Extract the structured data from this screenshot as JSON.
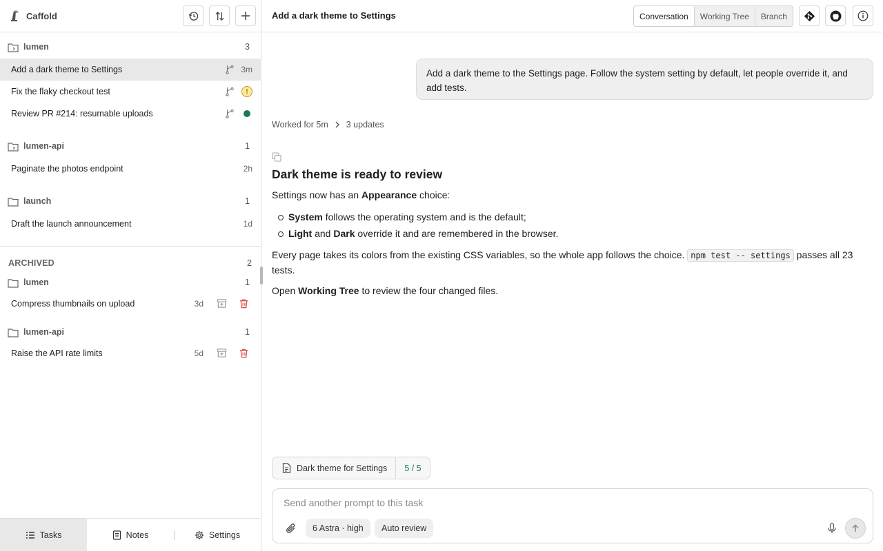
{
  "app": {
    "name": "Caffold"
  },
  "sidebar": {
    "groups": [
      {
        "name": "lumen",
        "count": "3",
        "tasks": [
          {
            "title": "Add a dark theme to Settings",
            "meta": "3m"
          },
          {
            "title": "Fix the flaky checkout test",
            "status": "warning"
          },
          {
            "title": "Review PR #214: resumable uploads",
            "status": "done"
          }
        ]
      },
      {
        "name": "lumen-api",
        "count": "1",
        "tasks": [
          {
            "title": "Paginate the photos endpoint",
            "meta": "2h"
          }
        ]
      },
      {
        "name": "launch",
        "count": "1",
        "tasks": [
          {
            "title": "Draft the launch announcement",
            "meta": "1d"
          }
        ]
      }
    ],
    "archived": {
      "label": "ARCHIVED",
      "count": "2",
      "groups": [
        {
          "name": "lumen",
          "count": "1",
          "task": {
            "title": "Compress thumbnails on upload",
            "age": "3d"
          }
        },
        {
          "name": "lumen-api",
          "count": "1",
          "task": {
            "title": "Raise the API rate limits",
            "age": "5d"
          }
        }
      ]
    },
    "footer": {
      "tasks": "Tasks",
      "notes": "Notes",
      "settings": "Settings"
    }
  },
  "main": {
    "title": "Add a dark theme to Settings",
    "tabs": {
      "conversation": "Conversation",
      "working_tree": "Working Tree",
      "branch": "Branch"
    },
    "user_message": "Add a dark theme to the Settings page. Follow the system setting by default, let people override it, and add tests.",
    "worked": {
      "label": "Worked for 5m",
      "updates": "3 updates"
    },
    "answer": {
      "heading": "Dark theme is ready to review",
      "intro_before": "Settings now has an ",
      "intro_bold": "Appearance",
      "intro_after": " choice:",
      "b1_bold": "System",
      "b1_text": " follows the operating system and is the default;",
      "b2_bold1": "Light",
      "b2_mid": " and ",
      "b2_bold2": "Dark",
      "b2_text": " override it and are remembered in the browser.",
      "p2_before": "Every page takes its colors from the existing CSS variables, so the whole app follows the choice. ",
      "p2_code": "npm test -- settings",
      "p2_after": " passes all 23 tests.",
      "p3_before": "Open ",
      "p3_bold": "Working Tree",
      "p3_after": " to review the four changed files."
    },
    "plan": {
      "title": "Dark theme for Settings",
      "progress": "5 / 5"
    },
    "composer": {
      "placeholder": "Send another prompt to this task",
      "model": "6 Astra  · high",
      "review": "Auto review"
    }
  },
  "colors": {
    "accent_green": "#1d7a50",
    "warning": "#c79a10",
    "active_row": "#e8e8e8"
  }
}
